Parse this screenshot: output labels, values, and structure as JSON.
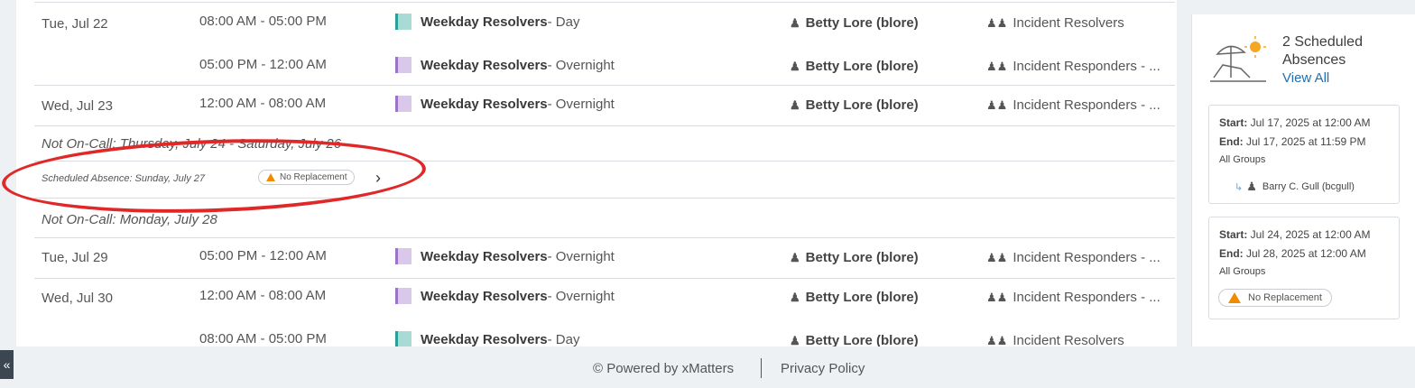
{
  "rows": [
    {
      "date": "Tue, Jul 22",
      "time": "08:00 AM - 05:00 PM",
      "schedule": "Weekday Resolvers",
      "shift": " - Day",
      "kind": "day",
      "person": "Betty Lore (blore)",
      "group": "Incident Resolvers"
    },
    {
      "date": "",
      "time": "05:00 PM - 12:00 AM",
      "schedule": "Weekday Resolvers",
      "shift": " - Overnight",
      "kind": "night",
      "person": "Betty Lore (blore)",
      "group": "Incident Responders - ..."
    },
    {
      "date": "Wed, Jul 23",
      "time": "12:00 AM - 08:00 AM",
      "schedule": "Weekday Resolvers",
      "shift": " - Overnight",
      "kind": "night",
      "person": "Betty Lore (blore)",
      "group": "Incident Responders - ..."
    },
    {
      "date": "Tue, Jul 29",
      "time": "05:00 PM - 12:00 AM",
      "schedule": "Weekday Resolvers",
      "shift": " - Overnight",
      "kind": "night",
      "person": "Betty Lore (blore)",
      "group": "Incident Responders - ..."
    },
    {
      "date": "Wed, Jul 30",
      "time": "12:00 AM - 08:00 AM",
      "schedule": "Weekday Resolvers",
      "shift": " - Overnight",
      "kind": "night",
      "person": "Betty Lore (blore)",
      "group": "Incident Responders - ..."
    },
    {
      "date": "",
      "time": "08:00 AM - 05:00 PM",
      "schedule": "Weekday Resolvers",
      "shift": " - Day",
      "kind": "day",
      "person": "Betty Lore (blore)",
      "group": "Incident Resolvers"
    }
  ],
  "not_oncall_1": "Not On-Call: Thursday, July 24 - Saturday, July 26",
  "scheduled_absence": "Scheduled Absence: Sunday, July 27",
  "no_replacement": "No Replacement",
  "not_oncall_2": "Not On-Call: Monday, July 28",
  "side": {
    "title": "2 Scheduled Absences",
    "view_all": "View All",
    "cards": [
      {
        "start_label": "Start:",
        "start": " Jul 17, 2025 at 12:00 AM",
        "end_label": "End:",
        "end": " Jul 17, 2025 at 11:59 PM",
        "groups": "All Groups",
        "replacement": "Barry C. Gull (bcgull)"
      },
      {
        "start_label": "Start:",
        "start": " Jul 24, 2025 at 12:00 AM",
        "end_label": "End:",
        "end": " Jul 28, 2025 at 12:00 AM",
        "groups": "All Groups",
        "replacement": "No Replacement"
      }
    ]
  },
  "footer": {
    "powered": "© Powered by xMatters",
    "privacy": "Privacy Policy"
  },
  "icons": {
    "person": "person-icon",
    "group": "group-icon",
    "warning": "warning-icon",
    "chevron": "chevron-right-icon",
    "collapse": "double-chevron-left-icon",
    "beach": "beach-chair-icon"
  },
  "colors": {
    "day": "#a8dad6",
    "night": "#d9c8ea",
    "link": "#1f6fb2",
    "warning": "#f08c00",
    "annotation": "#e02828"
  }
}
